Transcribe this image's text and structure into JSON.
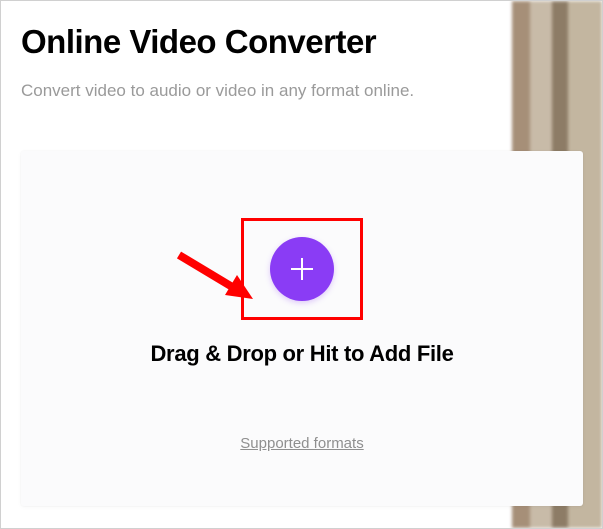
{
  "header": {
    "title": "Online Video Converter",
    "subtitle": "Convert video to audio or video in any format online."
  },
  "upload_card": {
    "drop_label": "Drag & Drop or Hit to Add File",
    "supported_link": "Supported formats"
  },
  "colors": {
    "accent": "#8a3cf5",
    "annotation": "#ff0000"
  }
}
